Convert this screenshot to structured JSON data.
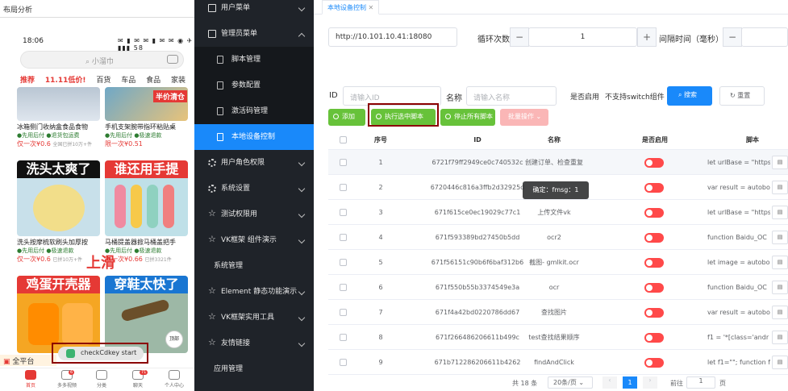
{
  "phone": {
    "window_title": "布局分析",
    "time": "18:06",
    "status_icons": "✉ ▮ ✉ ✉ ▮ ✉ ✉  ◉ ✈ ▮▮▮ 58",
    "search_placeholder": "小溜巾",
    "categories": [
      "推荐",
      "11.11低价!",
      "百货",
      "车品",
      "食品",
      "家装"
    ],
    "cards": [
      {
        "title": "冰箱侧门收纳盒食品食物",
        "service": "●先用后付 ●退货包运费",
        "price": "仅一次¥0.6",
        "sold": "全国已拼10万+件"
      },
      {
        "title": "手机支架腕带指环粘贴桌",
        "service": "●先用后付 ●极速退款",
        "price": "限一次¥0.51",
        "sold": ""
      },
      {
        "title": "洗头按摩梳软刷头加厚按",
        "service": "●先用后付 ●极速退款",
        "price": "仅一次¥0.6",
        "sold": "已拼10万+件"
      },
      {
        "title": "马桶提盖器掀马桶盖把手",
        "service": "●先用后付 ●极速退款",
        "price": "限一次¥0.66",
        "sold": "已拼3321件"
      }
    ],
    "overlay_captions": [
      "洗头太爽了",
      "谁还用手提",
      "鸡蛋开壳器",
      "穿鞋太快了"
    ],
    "promo_tag": "半价清仓",
    "slide_label": "上滑",
    "toast": "checkCdkey start",
    "all_platform": "全平台",
    "fab": "顶部",
    "tabs": [
      {
        "label": "首页",
        "badge": ""
      },
      {
        "label": "多多视频",
        "badge": "6"
      },
      {
        "label": "分类",
        "badge": ""
      },
      {
        "label": "聊天",
        "badge": "71"
      },
      {
        "label": "个人中心",
        "badge": ""
      }
    ]
  },
  "sidebar": {
    "items": [
      {
        "label": "用户菜单",
        "icon": "folder-icon"
      },
      {
        "label": "管理员菜单",
        "icon": "folder-icon"
      },
      {
        "label": "脚本管理",
        "icon": "doc-icon"
      },
      {
        "label": "参数配置",
        "icon": "doc-icon"
      },
      {
        "label": "激活码管理",
        "icon": "doc-icon"
      },
      {
        "label": "本地设备控制",
        "icon": "doc-icon"
      },
      {
        "label": "用户角色权限",
        "icon": "gear-icon"
      },
      {
        "label": "系统设置",
        "icon": "gear-icon"
      },
      {
        "label": "测试权限用",
        "icon": "star-icon"
      },
      {
        "label": "VK框架 组件演示",
        "icon": "star-icon"
      },
      {
        "label": "系统管理",
        "icon": ""
      },
      {
        "label": "Element 静态功能演示",
        "icon": "star-icon"
      },
      {
        "label": "VK框架实用工具",
        "icon": "star-icon"
      },
      {
        "label": "友情链接",
        "icon": "star-icon"
      },
      {
        "label": "应用管理",
        "icon": ""
      }
    ]
  },
  "main": {
    "tab": "本地设备控制",
    "url": "http://10.101.10.41:18080",
    "loop_label": "循环次数",
    "loop_value": "1",
    "interval_label": "间隔时间（毫秒）",
    "id_label": "ID",
    "id_placeholder": "请输入ID",
    "name_label": "名称",
    "name_placeholder": "请输入名称",
    "enabled_label": "是否启用",
    "switch_note": "不支持switch组件",
    "search_btn": "搜索",
    "reset_btn": "重置",
    "add_btn": "添加",
    "run_btn": "执行选中脚本",
    "stop_btn": "停止所有脚本",
    "batch_btn": "批量操作",
    "table": {
      "headers": [
        "序号",
        "ID",
        "名称",
        "是否启用",
        "脚本"
      ],
      "rows": [
        {
          "no": "1",
          "id": "6721f79ff2949ce0c740532c",
          "name": "创建订单、检查重复",
          "script": "let urlBase = \"https"
        },
        {
          "no": "2",
          "id": "6720446c816a3ffb2d32925d",
          "name": "",
          "script": "var result = autobo"
        },
        {
          "no": "3",
          "id": "671f615ce0ec19029c77c1",
          "name": "上传文件vk",
          "script": "let urlBase = \"https"
        },
        {
          "no": "4",
          "id": "671f593389bd27450b5dd",
          "name": "ocr2",
          "script": "function Baidu_OC"
        },
        {
          "no": "5",
          "id": "671f56151c90b6f6baf312b6",
          "name": "截图- gmlkit.ocr",
          "script": "let image = autobo"
        },
        {
          "no": "6",
          "id": "671f550b55b3374549e3a",
          "name": "ocr",
          "script": "function Baidu_OC"
        },
        {
          "no": "7",
          "id": "671f4a42bd0220786dd67",
          "name": "查找图片",
          "script": "var result = autobo"
        },
        {
          "no": "8",
          "id": "671f266486206611b499c",
          "name": "test查找结果顺序",
          "script": "f1 = '*[class='andr"
        },
        {
          "no": "9",
          "id": "671b712286206611b4262",
          "name": "findAndClick",
          "script": "let f1=\"\"; function f"
        }
      ]
    },
    "tooltip": "确定：fmsg：1",
    "pager": {
      "total": "共 18 条",
      "size": "20条/页",
      "current": "1",
      "goto": "前往",
      "page": "1",
      "unit": "页"
    }
  }
}
